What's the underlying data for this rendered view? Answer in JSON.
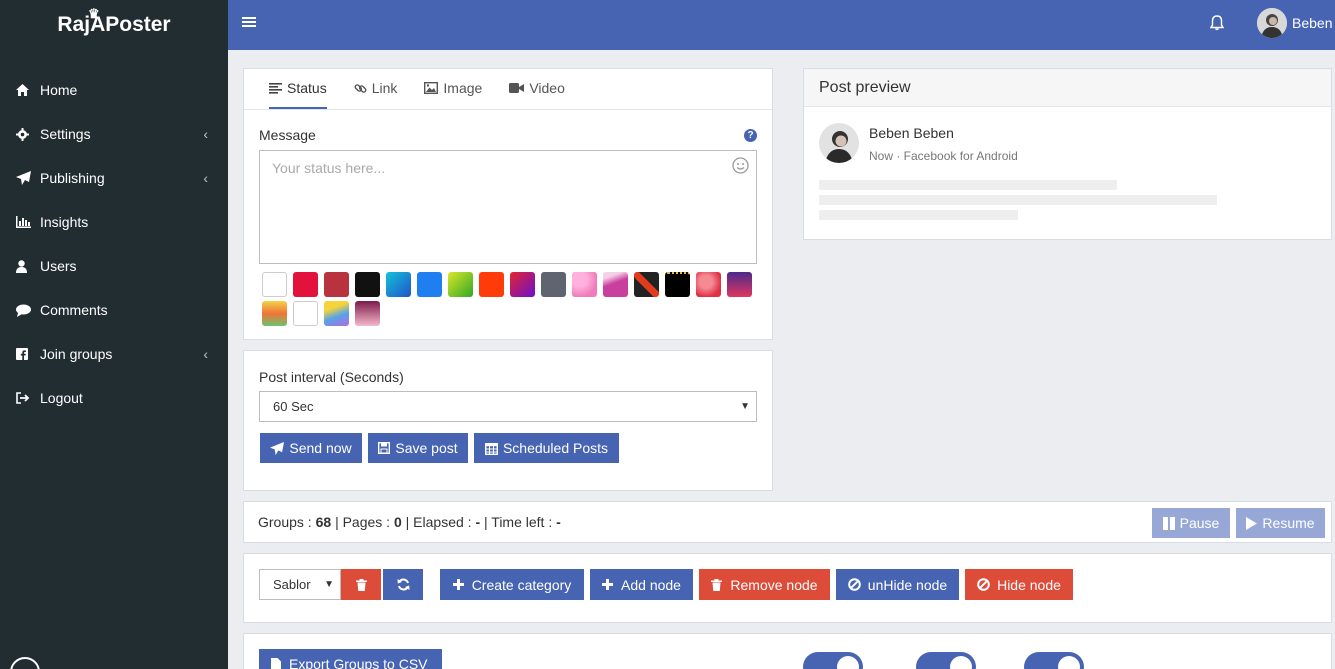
{
  "app": {
    "logo_text": "RajAPoster"
  },
  "sidebar": {
    "items": [
      {
        "label": "Home",
        "icon": "home-icon",
        "submenu": false
      },
      {
        "label": "Settings",
        "icon": "gear-icon",
        "submenu": true
      },
      {
        "label": "Publishing",
        "icon": "paper-plane-icon",
        "submenu": true
      },
      {
        "label": "Insights",
        "icon": "bar-chart-icon",
        "submenu": false
      },
      {
        "label": "Users",
        "icon": "user-icon",
        "submenu": false
      },
      {
        "label": "Comments",
        "icon": "comment-icon",
        "submenu": false
      },
      {
        "label": "Join groups",
        "icon": "facebook-icon",
        "submenu": true
      },
      {
        "label": "Logout",
        "icon": "sign-out-icon",
        "submenu": false
      }
    ]
  },
  "topbar": {
    "user_name": "Beben"
  },
  "composer": {
    "tabs": [
      {
        "label": "Status",
        "icon": "align-left-icon",
        "active": true
      },
      {
        "label": "Link",
        "icon": "link-icon",
        "active": false
      },
      {
        "label": "Image",
        "icon": "image-icon",
        "active": false
      },
      {
        "label": "Video",
        "icon": "video-camera-icon",
        "active": false
      }
    ],
    "message_label": "Message",
    "message_placeholder": "Your status here...",
    "swatches": [
      "#ffffff",
      "#e3123d",
      "#b8333e",
      "#111111",
      "#16a3d6",
      "#1f7ff0",
      "#7ecb20",
      "#ff3b0a",
      "#a21ab2",
      "#5f6470",
      "#f78fc8",
      "#c93f9d",
      "#e03b1a",
      "#000000",
      "#e84a60",
      "#6a2c86",
      "#f4b73a",
      "#ffffff",
      "#55a3e8",
      "#7c1a4b"
    ]
  },
  "interval": {
    "label": "Post interval (Seconds)",
    "selected": "60 Sec",
    "send_label": "Send now",
    "save_label": "Save post",
    "scheduled_label": "Scheduled Posts"
  },
  "preview": {
    "title": "Post preview",
    "name": "Beben Beben",
    "meta": "Now · Facebook for Android"
  },
  "status_bar": {
    "groups_label": "Groups :",
    "groups_value": "68",
    "pages_label": "| Pages :",
    "pages_value": "0",
    "elapsed_label": "| Elapsed :",
    "elapsed_value": "-",
    "timeleft_label": "| Time left :",
    "timeleft_value": "-",
    "pause_label": "Pause",
    "resume_label": "Resume"
  },
  "category": {
    "selected": "Sablor",
    "create_label": "Create category",
    "add_node_label": "Add node",
    "remove_node_label": "Remove node",
    "unhide_label": "unHide node",
    "hide_label": "Hide node"
  },
  "export": {
    "label": "Export Groups to CSV"
  },
  "colors": {
    "primary": "#4764b3",
    "danger": "#dd4b39",
    "sidebar": "#222d32"
  }
}
